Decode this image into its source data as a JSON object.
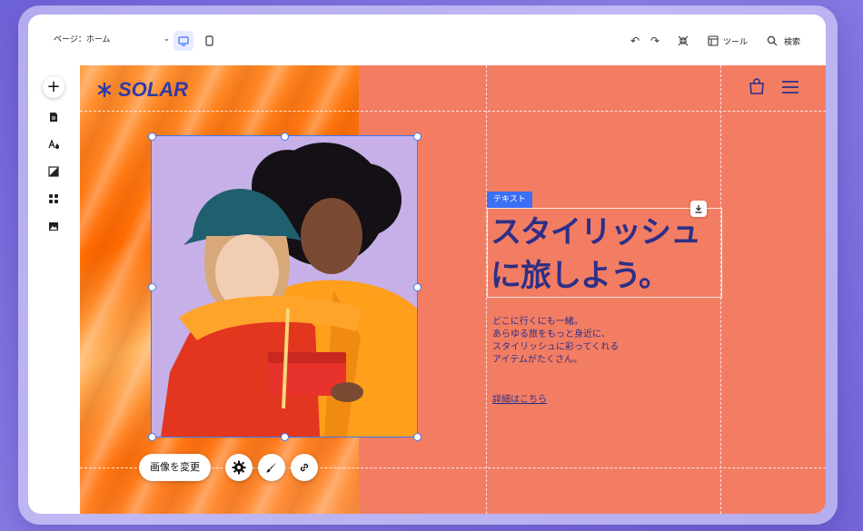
{
  "toolbar": {
    "page_selector": "ページ：ホーム",
    "tools_label": "ツール",
    "search_label": "検索",
    "icons": [
      "desktop-icon",
      "mobile-icon",
      "undo-icon",
      "redo-icon",
      "collapse-icon",
      "layout-panel-icon",
      "search-icon"
    ]
  },
  "sidebar": {
    "items": [
      {
        "name": "add-element",
        "icon": "plus-icon"
      },
      {
        "name": "pages",
        "icon": "document-icon"
      },
      {
        "name": "theme",
        "icon": "font-color-icon"
      },
      {
        "name": "background",
        "icon": "contrast-icon"
      },
      {
        "name": "apps",
        "icon": "grid-icon"
      },
      {
        "name": "media",
        "icon": "image-icon"
      }
    ]
  },
  "site": {
    "logo_text": "SOLAR",
    "text_tag": "テキスト",
    "heading": "スタイリッシュに旅しよう。",
    "body_lines": [
      "どこに行くにも一緒。",
      "あらゆる旅をもっと身近に、",
      "スタイリッシュに彩ってくれる",
      "アイテムがたくさん。"
    ],
    "link_text": "詳細はこちら",
    "bag_label": "SOLAR"
  },
  "image_toolbar": {
    "change_label": "画像を変更",
    "icons": [
      "settings-icon",
      "brush-icon",
      "link-icon"
    ]
  },
  "colors": {
    "accent": "#3b6ff5",
    "canvas_coral": "#f37d63",
    "text_navy": "#2d2f87",
    "orange": "#ff7410"
  }
}
